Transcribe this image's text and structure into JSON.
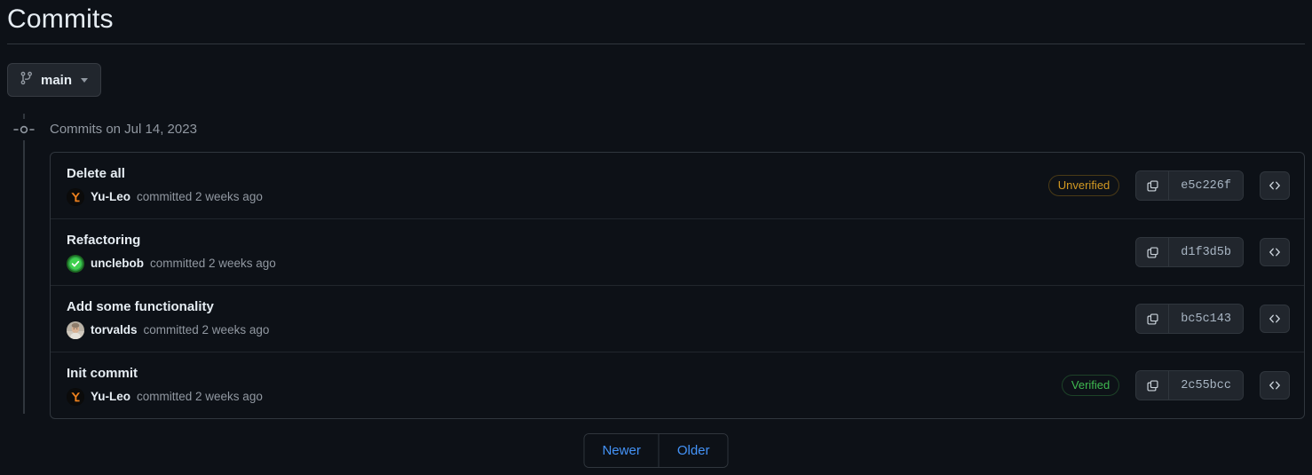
{
  "page": {
    "title": "Commits"
  },
  "branch_selector": {
    "label": "main",
    "icon": "git-branch-icon",
    "caret": "chevron-down-icon"
  },
  "timeline": {
    "node_icon": "commit-node-icon",
    "date_header": "Commits on Jul 14, 2023"
  },
  "commits": [
    {
      "message": "Delete all",
      "author": "Yu-Leo",
      "meta": "committed 2 weeks ago",
      "avatar": "avatar-yuleo",
      "verification": "Unverified",
      "verification_state": "unverified",
      "sha": "e5c226f",
      "copy_icon": "copy-icon",
      "code_icon": "code-icon"
    },
    {
      "message": "Refactoring",
      "author": "unclebob",
      "meta": "committed 2 weeks ago",
      "avatar": "avatar-unclebob",
      "verification": "",
      "verification_state": "none",
      "sha": "d1f3d5b",
      "copy_icon": "copy-icon",
      "code_icon": "code-icon"
    },
    {
      "message": "Add some functionality",
      "author": "torvalds",
      "meta": "committed 2 weeks ago",
      "avatar": "avatar-torvalds",
      "verification": "",
      "verification_state": "none",
      "sha": "bc5c143",
      "copy_icon": "copy-icon",
      "code_icon": "code-icon"
    },
    {
      "message": "Init commit",
      "author": "Yu-Leo",
      "meta": "committed 2 weeks ago",
      "avatar": "avatar-yuleo",
      "verification": "Verified",
      "verification_state": "verified",
      "sha": "2c55bcc",
      "copy_icon": "copy-icon",
      "code_icon": "code-icon"
    }
  ],
  "pagination": {
    "newer": "Newer",
    "older": "Older"
  },
  "colors": {
    "background": "#0d1117",
    "border": "#30363d",
    "text": "#e6edf3",
    "muted": "#9198a1",
    "link": "#4493f8",
    "verified": "#3fb950",
    "unverified": "#d29922"
  }
}
